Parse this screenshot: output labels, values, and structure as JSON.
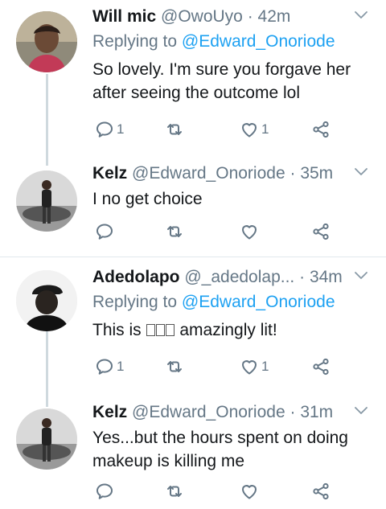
{
  "tweets": [
    {
      "name": "Will mic",
      "handle": "@OwoUyo",
      "dot": "·",
      "time": "42m",
      "replying_prefix": "Replying to ",
      "replying_to": "@Edward_Onoriode",
      "text": "So lovely. I'm sure you forgave her after seeing the outcome lol",
      "reply_count": "1",
      "like_count": "1"
    },
    {
      "name": "Kelz",
      "handle": "@Edward_Onoriode",
      "dot": "·",
      "time": "35m",
      "text": "I no get choice",
      "reply_count": "",
      "like_count": ""
    },
    {
      "name": "Adedolapo",
      "handle": "@_adedolap...",
      "dot": "·",
      "time": "34m",
      "replying_prefix": "Replying to ",
      "replying_to": "@Edward_Onoriode",
      "text_before": "This is ",
      "text_after": " amazingly lit!",
      "reply_count": "1",
      "like_count": "1"
    },
    {
      "name": "Kelz",
      "handle": "@Edward_Onoriode",
      "dot": "·",
      "time": "31m",
      "text": "Yes...but the hours spent on doing makeup is killing me",
      "reply_count": "",
      "like_count": ""
    }
  ],
  "icons": {
    "reply": "reply-icon",
    "retweet": "retweet-icon",
    "like": "heart-icon",
    "share": "share-icon",
    "more": "chevron-down-icon"
  },
  "colors": {
    "text": "#14171a",
    "muted": "#657786",
    "mention": "#1da1f2",
    "divider": "#e1e8ed",
    "thread_line": "#cfd9de"
  }
}
